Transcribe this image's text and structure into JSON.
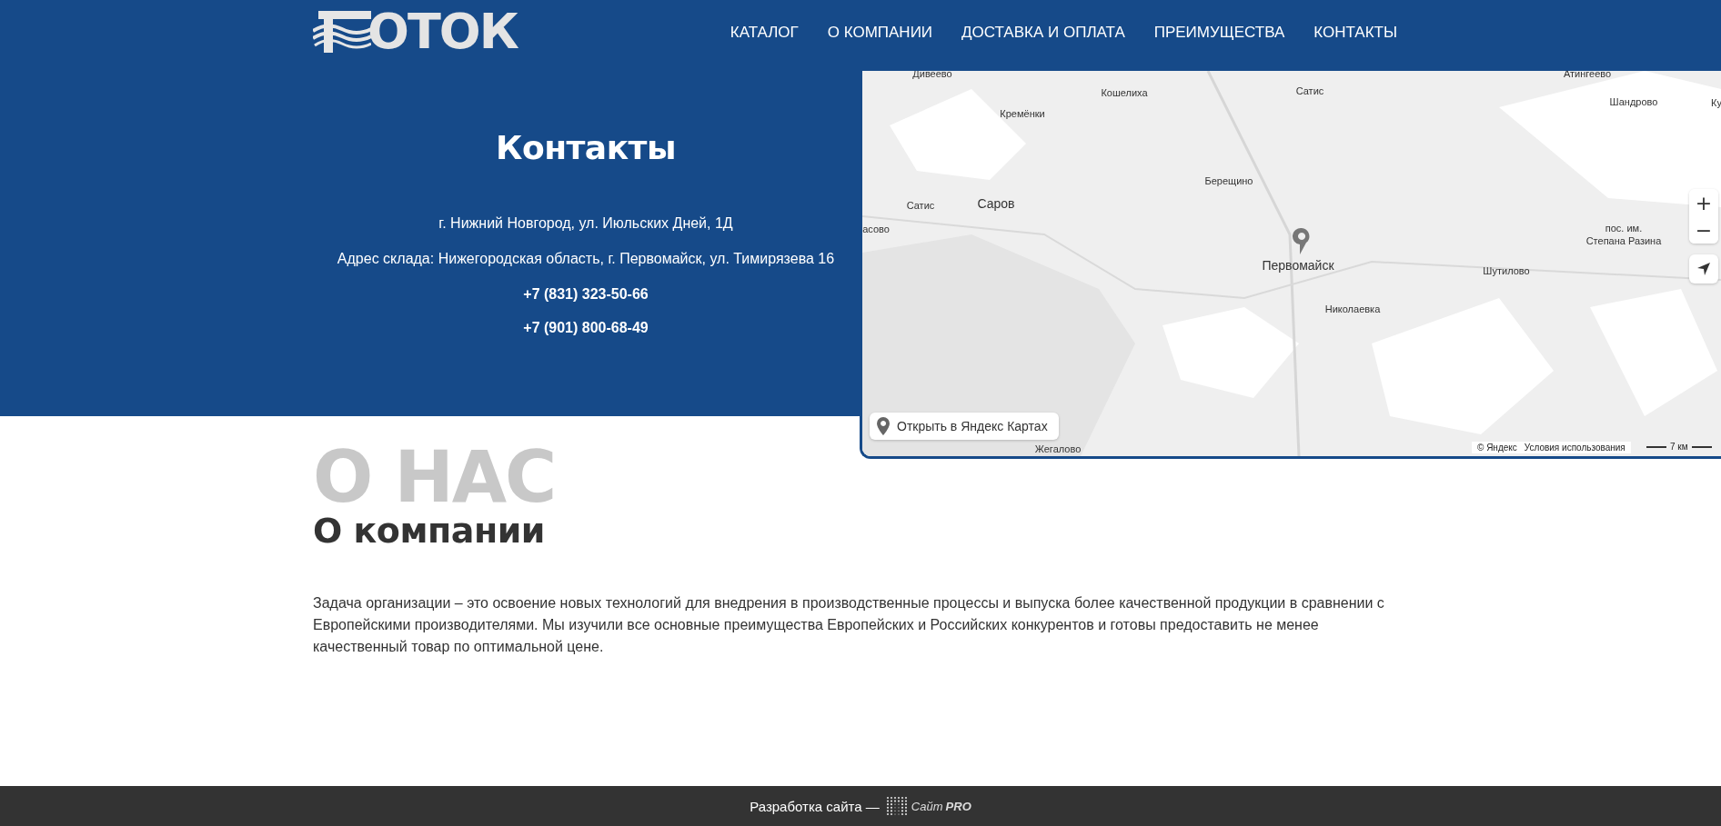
{
  "header": {
    "logo_text": "ОТОК",
    "nav": [
      {
        "label": "КАТАЛОГ"
      },
      {
        "label": "О КОМПАНИИ"
      },
      {
        "label": "ДОСТАВКА И ОПЛАТА"
      },
      {
        "label": "ПРЕИМУЩЕСТВА"
      },
      {
        "label": "КОНТАКТЫ"
      }
    ]
  },
  "contacts": {
    "title": "Контакты",
    "lines": [
      {
        "text": "г. Нижний Новгород, ул. Июльских Дней, 1Д",
        "kind": "address"
      },
      {
        "text": "Адрес склада: Нижегородская область, г. Первомайск, ул. Тимирязева 16",
        "kind": "address"
      },
      {
        "text": "+7 (831) 323-50-66",
        "kind": "phone"
      },
      {
        "text": "+7 (901) 800-68-49",
        "kind": "phone"
      }
    ]
  },
  "map": {
    "labels": [
      {
        "text": "Дивеево",
        "kind": "village"
      },
      {
        "text": "Кошелиха",
        "kind": "village"
      },
      {
        "text": "Сатис",
        "kind": "village"
      },
      {
        "text": "Атингеево",
        "kind": "village"
      },
      {
        "text": "Шандрово",
        "kind": "village"
      },
      {
        "text": "Ку",
        "kind": "village"
      },
      {
        "text": "Кремёнки",
        "kind": "village"
      },
      {
        "text": "Берещино",
        "kind": "village"
      },
      {
        "text": "Сатис",
        "kind": "village"
      },
      {
        "text": "Саров",
        "kind": "city"
      },
      {
        "text": "асово",
        "kind": "village"
      },
      {
        "text": "пос. им.",
        "kind": "village"
      },
      {
        "text": "Степана Разина",
        "kind": "village"
      },
      {
        "text": "Первомайск",
        "kind": "city"
      },
      {
        "text": "Шутилово",
        "kind": "village"
      },
      {
        "text": "Николаевка",
        "kind": "village"
      },
      {
        "text": "Жегалово",
        "kind": "village"
      }
    ],
    "zoom_in": "+",
    "zoom_out": "−",
    "open_link": "Открыть в Яндекс Картах",
    "copyright": "© Яндекс",
    "terms": "Условия использования",
    "scale": "7 км"
  },
  "about": {
    "watermark": "О НАС",
    "title": "О компании",
    "text": "Задача организации – это освоение новых технологий для внедрения в производственные процессы и выпуска более качественной продукции в сравнении с Европейскими производителями. Мы изучили все основные преимущества Европейских и Российских конкурентов и готовы предоставить не менее качественный товар по оптимальной цене."
  },
  "footer": {
    "text": "Разработка сайта —",
    "brand_prefix": "Сайт",
    "brand": "PRO"
  }
}
